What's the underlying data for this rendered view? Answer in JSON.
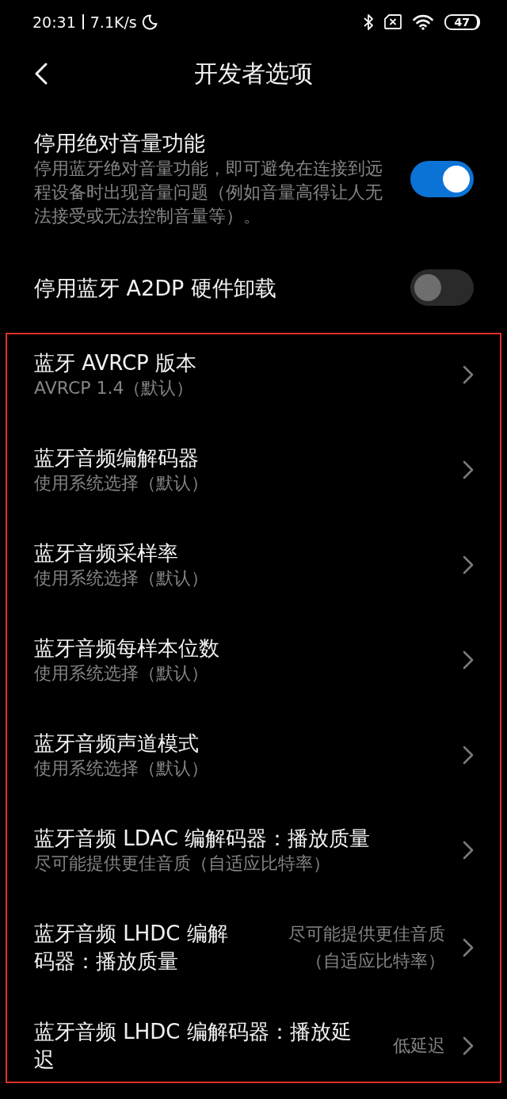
{
  "status_bar": {
    "time": "20:31",
    "network_speed": "7.1K/s",
    "battery": "47"
  },
  "header": {
    "title": "开发者选项"
  },
  "switch_settings": [
    {
      "title": "停用绝对音量功能",
      "description": "停用蓝牙绝对音量功能，即可避免在连接到远程设备时出现音量问题（例如音量高得让人无法接受或无法控制音量等）。",
      "on": true
    },
    {
      "title": "停用蓝牙 A2DP 硬件卸载",
      "on": false
    }
  ],
  "highlighted_settings": [
    {
      "kind": "summary",
      "title": "蓝牙 AVRCP 版本",
      "summary": "AVRCP 1.4（默认）"
    },
    {
      "kind": "summary",
      "title": "蓝牙音频编解码器",
      "summary": "使用系统选择（默认）"
    },
    {
      "kind": "summary",
      "title": "蓝牙音频采样率",
      "summary": "使用系统选择（默认）"
    },
    {
      "kind": "summary",
      "title": "蓝牙音频每样本位数",
      "summary": "使用系统选择（默认）"
    },
    {
      "kind": "summary",
      "title": "蓝牙音频声道模式",
      "summary": "使用系统选择（默认）"
    },
    {
      "kind": "summary",
      "title": "蓝牙音频 LDAC 编解码器：播放质量",
      "summary": "尽可能提供更佳音质（自适应比特率）"
    },
    {
      "kind": "value",
      "title": "蓝牙音频 LHDC 编解码器：播放质量",
      "value": "尽可能提供更佳音质（自适应比特率）"
    },
    {
      "kind": "value",
      "title": "蓝牙音频 LHDC 编解码器：播放延迟",
      "value": "低延迟"
    }
  ]
}
